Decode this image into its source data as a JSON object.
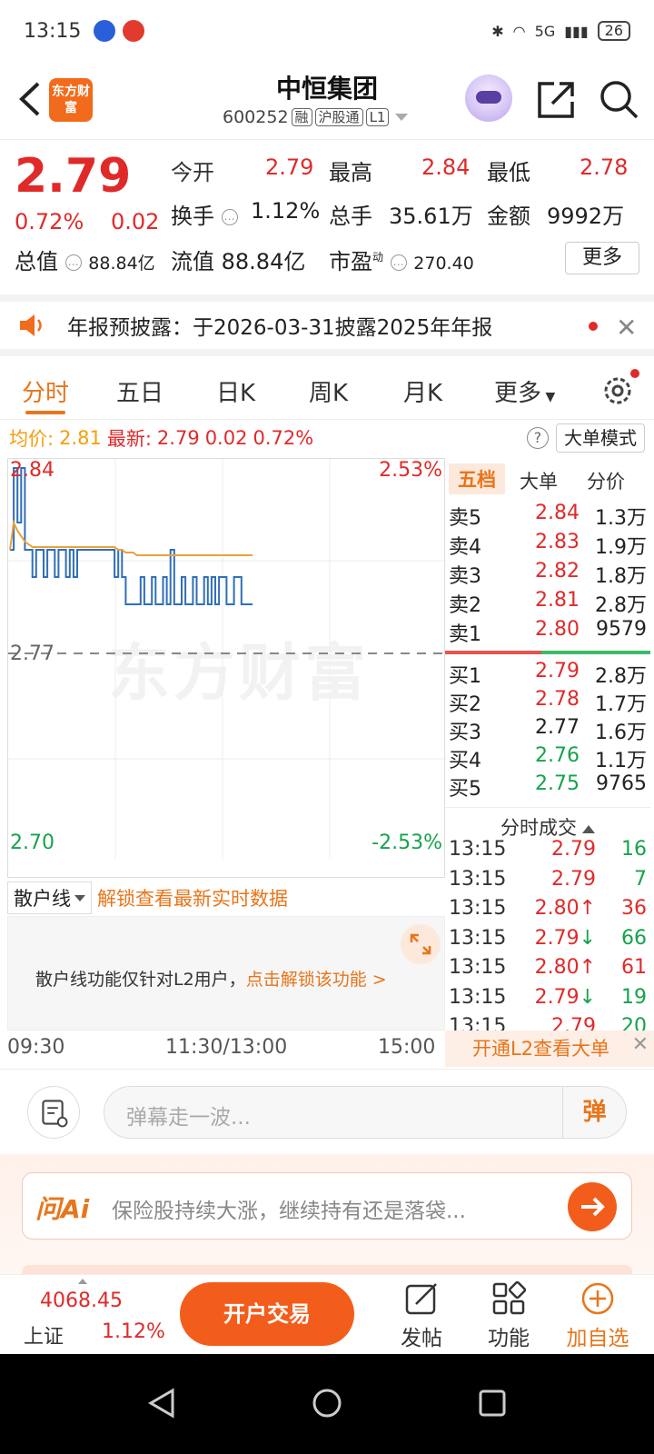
{
  "status_bar": {
    "time": "13:15",
    "network": "5G",
    "battery": "26"
  },
  "header": {
    "logo_text": "东方财富",
    "title": "中恒集团",
    "code": "600252",
    "tags": [
      "融",
      "沪股通",
      "L1"
    ]
  },
  "quote": {
    "price": "2.79",
    "change_pct": "0.72%",
    "change_val": "0.02",
    "open_label": "今开",
    "open": "2.79",
    "high_label": "最高",
    "high": "2.84",
    "low_label": "最低",
    "low": "2.78",
    "turnover_label": "换手",
    "turnover": "1.12%",
    "volume_label": "总手",
    "volume": "35.61万",
    "amount_label": "金额",
    "amount": "9992万",
    "mktcap_label": "总值",
    "mktcap": "88.84亿",
    "float_label": "流值",
    "float": "88.84亿",
    "pe_label": "市盈",
    "pe_sup": "动",
    "pe": "270.40",
    "more_label": "更多"
  },
  "notice": {
    "text": "年报预披露：于2026-03-31披露2025年年报"
  },
  "tabs": [
    "分时",
    "五日",
    "日K",
    "周K",
    "月K",
    "更多"
  ],
  "avg_bar": {
    "avg_label": "均价:",
    "avg": "2.81",
    "latest_label": "最新:",
    "latest": "2.79",
    "chg": "0.02",
    "pct": "0.72%",
    "help": "?",
    "big_mode": "大单模式"
  },
  "chart_labels": {
    "top_price": "2.84",
    "top_pct": "2.53%",
    "mid_price": "2.77",
    "bottom_price": "2.70",
    "bottom_pct": "-2.53%",
    "watermark": "东方财富"
  },
  "chart_data": {
    "type": "line",
    "ylim": [
      2.7,
      2.84
    ],
    "prev_close": 2.77,
    "series": [
      {
        "name": "",
        "color": "#2f6fb7",
        "values": [
          2.81,
          2.84,
          2.82,
          2.84,
          2.81,
          2.81,
          2.8,
          2.81,
          2.81,
          2.8,
          2.81,
          2.81,
          2.8,
          2.81,
          2.81,
          2.8,
          2.81,
          2.8,
          2.81,
          2.81,
          2.81,
          2.81,
          2.81,
          2.81,
          2.81,
          2.81,
          2.81,
          2.81,
          2.8,
          2.81,
          2.8,
          2.79,
          2.79,
          2.79,
          2.79,
          2.8,
          2.79,
          2.79,
          2.8,
          2.79,
          2.79,
          2.8,
          2.79,
          2.81,
          2.79,
          2.79,
          2.8,
          2.79,
          2.79,
          2.8,
          2.79,
          2.79,
          2.8,
          2.79,
          2.8,
          2.79,
          2.8,
          2.8,
          2.79,
          2.79,
          2.8,
          2.8,
          2.79,
          2.79,
          2.79,
          2.79
        ]
      },
      {
        "name": "",
        "color": "#e8a23a",
        "values": [
          2.81,
          2.82,
          2.817,
          2.815,
          2.813,
          2.812,
          2.811,
          2.811,
          2.811,
          2.811,
          2.811,
          2.811,
          2.811,
          2.811,
          2.811,
          2.811,
          2.811,
          2.811,
          2.811,
          2.811,
          2.811,
          2.811,
          2.811,
          2.811,
          2.811,
          2.811,
          2.811,
          2.811,
          2.811,
          2.81,
          2.81,
          2.809,
          2.809,
          2.809,
          2.808,
          2.808,
          2.808,
          2.808,
          2.808,
          2.808,
          2.808,
          2.808,
          2.808,
          2.808,
          2.808,
          2.808,
          2.808,
          2.808,
          2.808,
          2.808,
          2.808,
          2.808,
          2.808,
          2.808,
          2.808,
          2.808,
          2.808,
          2.808,
          2.808,
          2.808,
          2.808,
          2.808,
          2.808,
          2.808,
          2.808,
          2.808
        ]
      }
    ]
  },
  "order_book": {
    "tabs": [
      "五档",
      "大单",
      "分价"
    ],
    "asks": [
      {
        "label": "卖5",
        "price": "2.84",
        "vol": "1.3万",
        "c": "red"
      },
      {
        "label": "卖4",
        "price": "2.83",
        "vol": "1.9万",
        "c": "red"
      },
      {
        "label": "卖3",
        "price": "2.82",
        "vol": "1.8万",
        "c": "red"
      },
      {
        "label": "卖2",
        "price": "2.81",
        "vol": "2.8万",
        "c": "red"
      },
      {
        "label": "卖1",
        "price": "2.80",
        "vol": "9579",
        "c": "red"
      }
    ],
    "bids": [
      {
        "label": "买1",
        "price": "2.79",
        "vol": "2.8万",
        "c": "red"
      },
      {
        "label": "买2",
        "price": "2.78",
        "vol": "1.7万",
        "c": "red"
      },
      {
        "label": "买3",
        "price": "2.77",
        "vol": "1.6万",
        "c": "dark"
      },
      {
        "label": "买4",
        "price": "2.76",
        "vol": "1.1万",
        "c": "green"
      },
      {
        "label": "买5",
        "price": "2.75",
        "vol": "9765",
        "c": "green"
      }
    ],
    "trades_title": "分时成交",
    "trades": [
      {
        "time": "13:15",
        "price": "2.79",
        "arrow": "",
        "vol": "16",
        "vc": "green"
      },
      {
        "time": "13:15",
        "price": "2.79",
        "arrow": "",
        "vol": "7",
        "vc": "green"
      },
      {
        "time": "13:15",
        "price": "2.80",
        "arrow": "↑",
        "vol": "36",
        "vc": "red"
      },
      {
        "time": "13:15",
        "price": "2.79",
        "arrow": "↓",
        "vol": "66",
        "vc": "green"
      },
      {
        "time": "13:15",
        "price": "2.80",
        "arrow": "↑",
        "vol": "61",
        "vc": "red"
      },
      {
        "time": "13:15",
        "price": "2.79",
        "arrow": "↓",
        "vol": "19",
        "vc": "green"
      },
      {
        "time": "13:15",
        "price": "2.79",
        "arrow": "",
        "vol": "20",
        "vc": "green"
      }
    ],
    "l2_banner": "开通L2查看大单"
  },
  "retail": {
    "select": "散户线",
    "unlock_link": "解锁查看最新实时数据",
    "panel_text": "散户线功能仅针对L2用户，",
    "panel_link": "点击解锁该功能 >"
  },
  "time_axis": {
    "start": "09:30",
    "mid": "11:30/13:00",
    "end": "15:00"
  },
  "danmu": {
    "placeholder": "弹幕走一波...",
    "send": "弹"
  },
  "ai": {
    "logo": "问Ai",
    "text": "保险股持续大涨，继续持有还是落袋..."
  },
  "bottom": {
    "index_val": "4068.45",
    "index_name": "上证",
    "index_pct": "1.12%",
    "trade_btn": "开户交易",
    "post": "发帖",
    "func": "功能",
    "add": "加自选"
  }
}
